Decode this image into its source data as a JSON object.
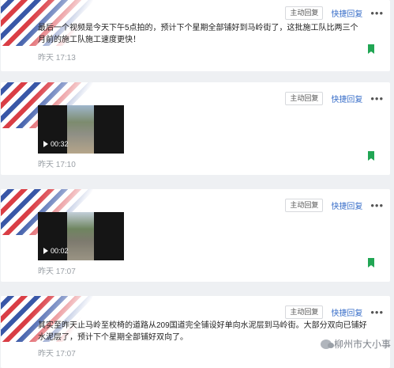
{
  "actions": {
    "author_reply": "主动回复",
    "quick_reply": "快捷回复",
    "more": "•••"
  },
  "comments": [
    {
      "text": "最后一个视频是今天下午5点拍的，预计下个星期全部铺好到马岭街了，这批施工队比两三个月前的施工队施工速度更快！",
      "time": "昨天 17:13"
    },
    {
      "video_duration": "00:32",
      "time": "昨天 17:10"
    },
    {
      "video_duration": "00:02",
      "time": "昨天 17:07"
    },
    {
      "text": "其实至昨天止马岭至校椅的道路从209国道完全铺设好单向水泥层到马岭街。大部分双向已铺好水泥层了，预计下个星期全部铺好双向了。",
      "time": "昨天 17:07"
    }
  ],
  "watermark": "柳州市大小事",
  "colors": {
    "accent_green": "#21a654",
    "link_blue": "#3a6fc9",
    "stripe_red": "#d8343c",
    "stripe_blue": "#2f4fa3"
  }
}
